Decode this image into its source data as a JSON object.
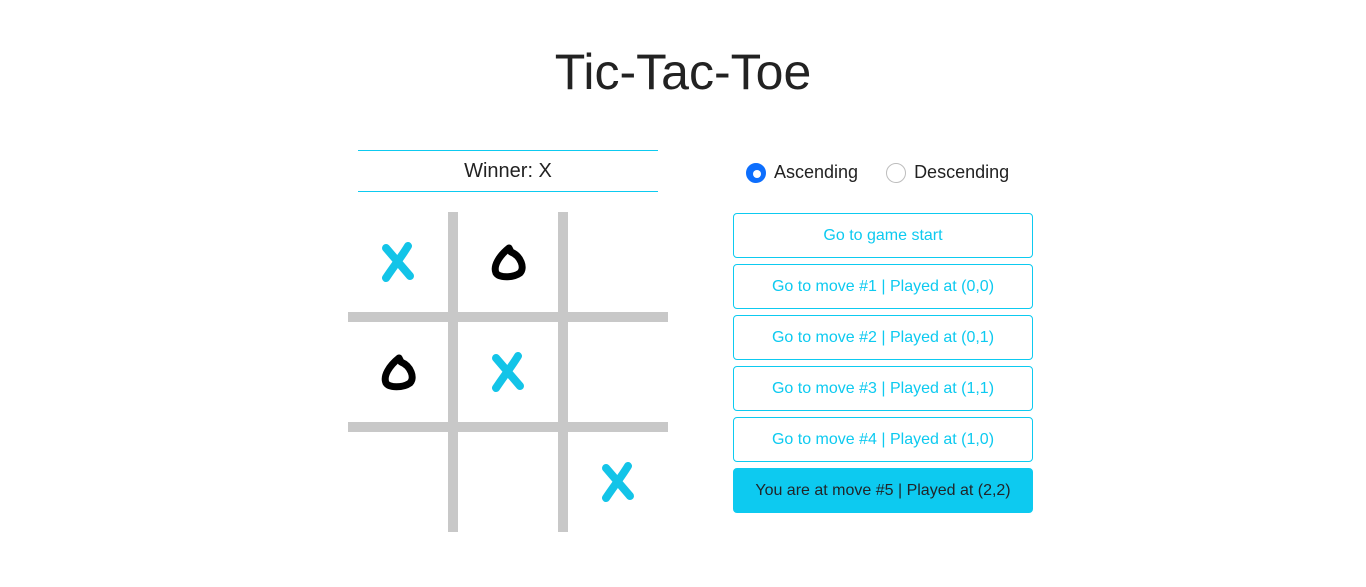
{
  "title": "Tic-Tac-Toe",
  "status": "Winner: X",
  "colors": {
    "accent": "#0dcaf0",
    "x_mark": "#13c4e8",
    "o_mark": "#000000",
    "grid": "#c8c8c8",
    "radio_checked": "#0d6efd"
  },
  "board": [
    [
      "X",
      "O",
      ""
    ],
    [
      "O",
      "X",
      ""
    ],
    [
      "",
      "",
      "X"
    ]
  ],
  "sort": {
    "ascending_label": "Ascending",
    "descending_label": "Descending",
    "selected": "ascending"
  },
  "moves": [
    {
      "label": "Go to game start",
      "current": false
    },
    {
      "label": "Go to move #1 | Played at (0,0)",
      "current": false
    },
    {
      "label": "Go to move #2 | Played at (0,1)",
      "current": false
    },
    {
      "label": "Go to move #3 | Played at (1,1)",
      "current": false
    },
    {
      "label": "Go to move #4 | Played at (1,0)",
      "current": false
    },
    {
      "label": "You are at move #5 | Played at (2,2)",
      "current": true
    }
  ]
}
